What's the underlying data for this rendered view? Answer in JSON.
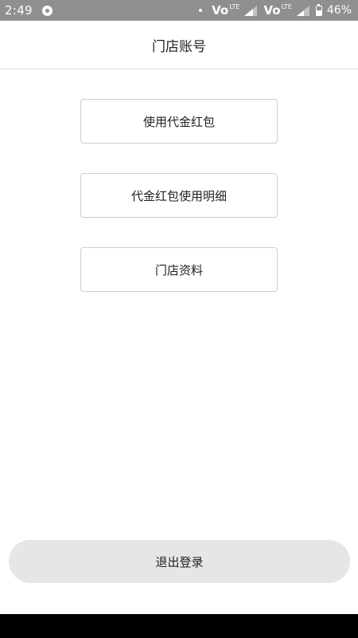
{
  "status_bar": {
    "time": "2:49",
    "network_1": "Vo",
    "network_1_sup": "LTE",
    "network_2": "Vo",
    "network_2_sup": "LTE",
    "battery_percent": "46%",
    "battery_level": 0.46
  },
  "header": {
    "title": "门店账号"
  },
  "menu": {
    "items": [
      {
        "label": "使用代金红包"
      },
      {
        "label": "代金红包使用明细"
      },
      {
        "label": "门店资料"
      }
    ]
  },
  "logout": {
    "label": "退出登录"
  }
}
